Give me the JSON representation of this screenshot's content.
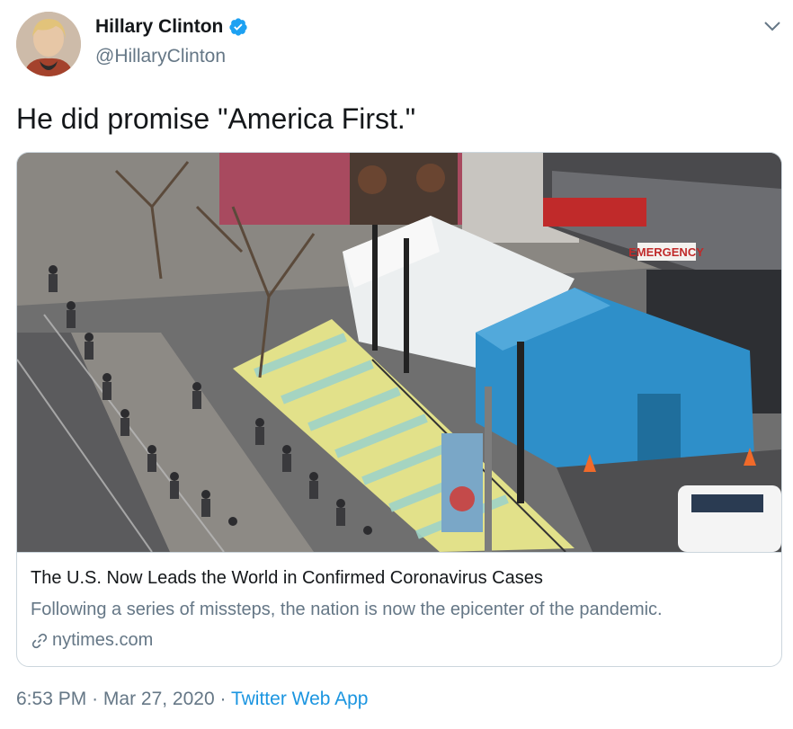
{
  "author": {
    "name": "Hillary Clinton",
    "handle": "@HillaryClinton",
    "verified_icon": "verified-badge-icon",
    "avatar_icon": "avatar"
  },
  "tweet": {
    "text": "He did promise \"America First.\""
  },
  "card": {
    "title": "The U.S. Now Leads the World in Confirmed Coronavirus Cases",
    "description": "Following a series of missteps, the nation is now the epicenter of the pandemic.",
    "domain": "nytimes.com",
    "image_signs": {
      "emergency": "EMERGENCY"
    }
  },
  "meta": {
    "time": "6:53 PM",
    "separator": "·",
    "date": "Mar 27, 2020",
    "app": "Twitter Web App"
  },
  "colors": {
    "link_blue": "#1b95e0",
    "secondary_text": "#657786",
    "tent_blue": "#2e8fc9"
  }
}
